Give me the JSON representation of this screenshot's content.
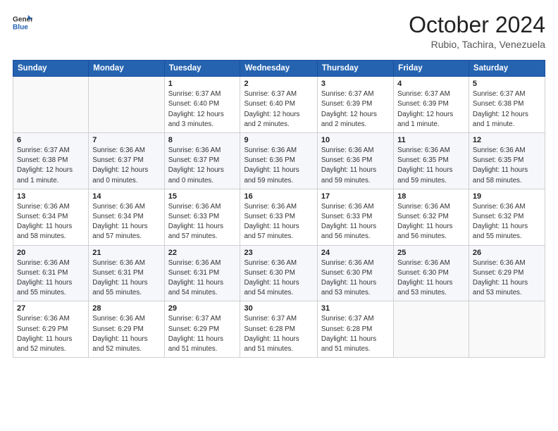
{
  "header": {
    "logo_line1": "General",
    "logo_line2": "Blue",
    "month": "October 2024",
    "location": "Rubio, Tachira, Venezuela"
  },
  "days_of_week": [
    "Sunday",
    "Monday",
    "Tuesday",
    "Wednesday",
    "Thursday",
    "Friday",
    "Saturday"
  ],
  "weeks": [
    [
      {
        "day": "",
        "info": ""
      },
      {
        "day": "",
        "info": ""
      },
      {
        "day": "1",
        "info": "Sunrise: 6:37 AM\nSunset: 6:40 PM\nDaylight: 12 hours\nand 3 minutes."
      },
      {
        "day": "2",
        "info": "Sunrise: 6:37 AM\nSunset: 6:40 PM\nDaylight: 12 hours\nand 2 minutes."
      },
      {
        "day": "3",
        "info": "Sunrise: 6:37 AM\nSunset: 6:39 PM\nDaylight: 12 hours\nand 2 minutes."
      },
      {
        "day": "4",
        "info": "Sunrise: 6:37 AM\nSunset: 6:39 PM\nDaylight: 12 hours\nand 1 minute."
      },
      {
        "day": "5",
        "info": "Sunrise: 6:37 AM\nSunset: 6:38 PM\nDaylight: 12 hours\nand 1 minute."
      }
    ],
    [
      {
        "day": "6",
        "info": "Sunrise: 6:37 AM\nSunset: 6:38 PM\nDaylight: 12 hours\nand 1 minute."
      },
      {
        "day": "7",
        "info": "Sunrise: 6:36 AM\nSunset: 6:37 PM\nDaylight: 12 hours\nand 0 minutes."
      },
      {
        "day": "8",
        "info": "Sunrise: 6:36 AM\nSunset: 6:37 PM\nDaylight: 12 hours\nand 0 minutes."
      },
      {
        "day": "9",
        "info": "Sunrise: 6:36 AM\nSunset: 6:36 PM\nDaylight: 11 hours\nand 59 minutes."
      },
      {
        "day": "10",
        "info": "Sunrise: 6:36 AM\nSunset: 6:36 PM\nDaylight: 11 hours\nand 59 minutes."
      },
      {
        "day": "11",
        "info": "Sunrise: 6:36 AM\nSunset: 6:35 PM\nDaylight: 11 hours\nand 59 minutes."
      },
      {
        "day": "12",
        "info": "Sunrise: 6:36 AM\nSunset: 6:35 PM\nDaylight: 11 hours\nand 58 minutes."
      }
    ],
    [
      {
        "day": "13",
        "info": "Sunrise: 6:36 AM\nSunset: 6:34 PM\nDaylight: 11 hours\nand 58 minutes."
      },
      {
        "day": "14",
        "info": "Sunrise: 6:36 AM\nSunset: 6:34 PM\nDaylight: 11 hours\nand 57 minutes."
      },
      {
        "day": "15",
        "info": "Sunrise: 6:36 AM\nSunset: 6:33 PM\nDaylight: 11 hours\nand 57 minutes."
      },
      {
        "day": "16",
        "info": "Sunrise: 6:36 AM\nSunset: 6:33 PM\nDaylight: 11 hours\nand 57 minutes."
      },
      {
        "day": "17",
        "info": "Sunrise: 6:36 AM\nSunset: 6:33 PM\nDaylight: 11 hours\nand 56 minutes."
      },
      {
        "day": "18",
        "info": "Sunrise: 6:36 AM\nSunset: 6:32 PM\nDaylight: 11 hours\nand 56 minutes."
      },
      {
        "day": "19",
        "info": "Sunrise: 6:36 AM\nSunset: 6:32 PM\nDaylight: 11 hours\nand 55 minutes."
      }
    ],
    [
      {
        "day": "20",
        "info": "Sunrise: 6:36 AM\nSunset: 6:31 PM\nDaylight: 11 hours\nand 55 minutes."
      },
      {
        "day": "21",
        "info": "Sunrise: 6:36 AM\nSunset: 6:31 PM\nDaylight: 11 hours\nand 55 minutes."
      },
      {
        "day": "22",
        "info": "Sunrise: 6:36 AM\nSunset: 6:31 PM\nDaylight: 11 hours\nand 54 minutes."
      },
      {
        "day": "23",
        "info": "Sunrise: 6:36 AM\nSunset: 6:30 PM\nDaylight: 11 hours\nand 54 minutes."
      },
      {
        "day": "24",
        "info": "Sunrise: 6:36 AM\nSunset: 6:30 PM\nDaylight: 11 hours\nand 53 minutes."
      },
      {
        "day": "25",
        "info": "Sunrise: 6:36 AM\nSunset: 6:30 PM\nDaylight: 11 hours\nand 53 minutes."
      },
      {
        "day": "26",
        "info": "Sunrise: 6:36 AM\nSunset: 6:29 PM\nDaylight: 11 hours\nand 53 minutes."
      }
    ],
    [
      {
        "day": "27",
        "info": "Sunrise: 6:36 AM\nSunset: 6:29 PM\nDaylight: 11 hours\nand 52 minutes."
      },
      {
        "day": "28",
        "info": "Sunrise: 6:36 AM\nSunset: 6:29 PM\nDaylight: 11 hours\nand 52 minutes."
      },
      {
        "day": "29",
        "info": "Sunrise: 6:37 AM\nSunset: 6:29 PM\nDaylight: 11 hours\nand 51 minutes."
      },
      {
        "day": "30",
        "info": "Sunrise: 6:37 AM\nSunset: 6:28 PM\nDaylight: 11 hours\nand 51 minutes."
      },
      {
        "day": "31",
        "info": "Sunrise: 6:37 AM\nSunset: 6:28 PM\nDaylight: 11 hours\nand 51 minutes."
      },
      {
        "day": "",
        "info": ""
      },
      {
        "day": "",
        "info": ""
      }
    ]
  ]
}
